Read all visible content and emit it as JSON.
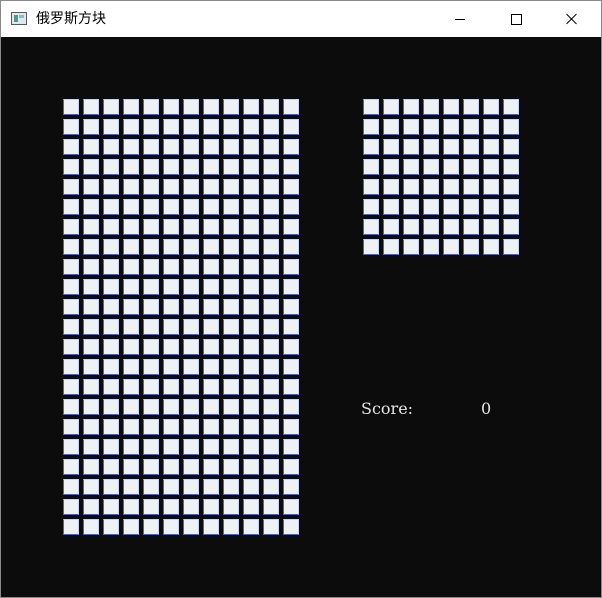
{
  "window": {
    "title": "俄罗斯方块",
    "icon": "tetris-window-icon",
    "controls": [
      "minimize",
      "maximize",
      "close"
    ]
  },
  "board": {
    "rows": 22,
    "cols": 12,
    "filled_cells": []
  },
  "next_preview": {
    "rows": 8,
    "cols": 8,
    "filled_cells": []
  },
  "score": {
    "label": "Score:",
    "value": "0"
  },
  "colors": {
    "background": "#0c0c0c",
    "cell_fill": "#eef2f5",
    "cell_border": "#3d5cff",
    "text": "#e6e6e6"
  }
}
